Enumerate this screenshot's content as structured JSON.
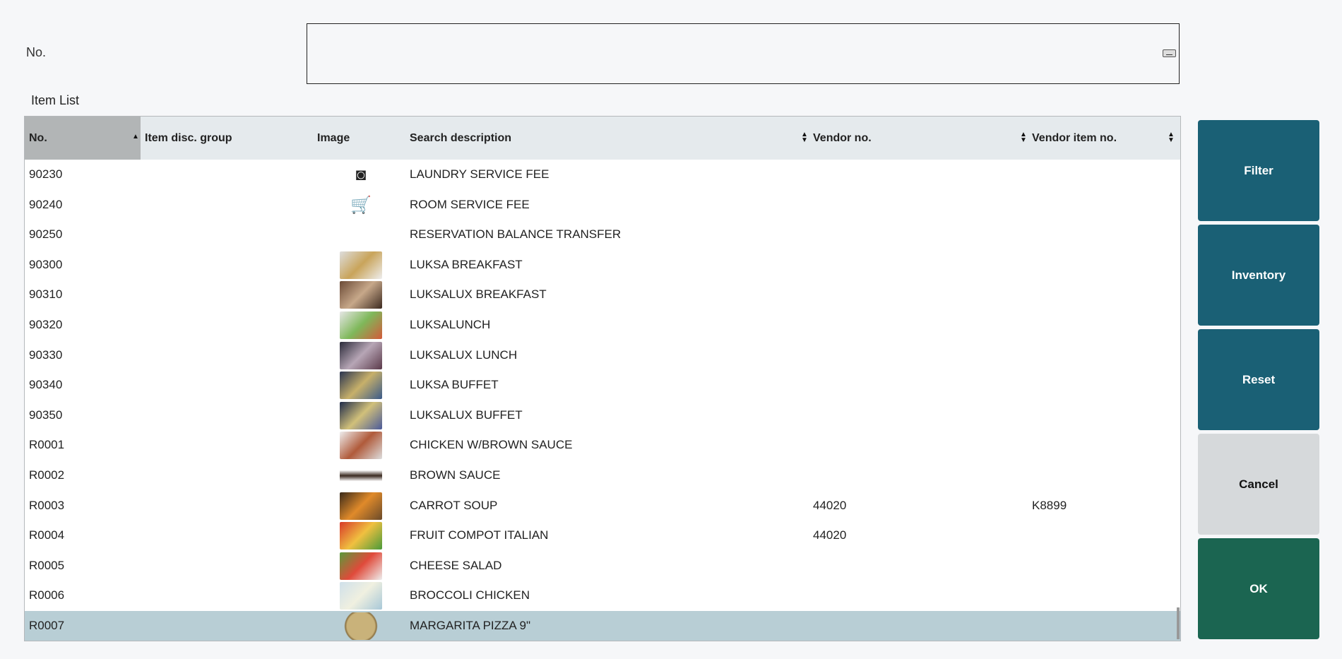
{
  "form": {
    "no_label": "No.",
    "no_value": "",
    "list_label": "Item List"
  },
  "columns": {
    "no": "No.",
    "disc_group": "Item disc. group",
    "image": "Image",
    "search_desc": "Search description",
    "vendor_no": "Vendor no.",
    "vendor_item_no": "Vendor item no."
  },
  "rows": [
    {
      "no": "90230",
      "desc": "LAUNDRY SERVICE FEE",
      "vendor": "",
      "vitem": "",
      "img": "laundry-icon"
    },
    {
      "no": "90240",
      "desc": "ROOM SERVICE FEE",
      "vendor": "",
      "vitem": "",
      "img": "room-service-icon"
    },
    {
      "no": "90250",
      "desc": "RESERVATION BALANCE TRANSFER",
      "vendor": "",
      "vitem": "",
      "img": ""
    },
    {
      "no": "90300",
      "desc": "LUKSA BREAKFAST",
      "vendor": "",
      "vitem": "",
      "img": "photo"
    },
    {
      "no": "90310",
      "desc": "LUKSALUX BREAKFAST",
      "vendor": "",
      "vitem": "",
      "img": "photo"
    },
    {
      "no": "90320",
      "desc": "LUKSALUNCH",
      "vendor": "",
      "vitem": "",
      "img": "photo"
    },
    {
      "no": "90330",
      "desc": "LUKSALUX LUNCH",
      "vendor": "",
      "vitem": "",
      "img": "photo"
    },
    {
      "no": "90340",
      "desc": "LUKSA BUFFET",
      "vendor": "",
      "vitem": "",
      "img": "photo"
    },
    {
      "no": "90350",
      "desc": "LUKSALUX BUFFET",
      "vendor": "",
      "vitem": "",
      "img": "photo"
    },
    {
      "no": "R0001",
      "desc": "CHICKEN W/BROWN SAUCE",
      "vendor": "",
      "vitem": "",
      "img": "photo"
    },
    {
      "no": "R0002",
      "desc": "BROWN SAUCE",
      "vendor": "",
      "vitem": "",
      "img": "photo"
    },
    {
      "no": "R0003",
      "desc": "CARROT SOUP",
      "vendor": "44020",
      "vitem": "K8899",
      "img": "photo"
    },
    {
      "no": "R0004",
      "desc": "FRUIT COMPOT ITALIAN",
      "vendor": "44020",
      "vitem": "",
      "img": "photo"
    },
    {
      "no": "R0005",
      "desc": "CHEESE SALAD",
      "vendor": "",
      "vitem": "",
      "img": "photo"
    },
    {
      "no": "R0006",
      "desc": "BROCCOLI CHICKEN",
      "vendor": "",
      "vitem": "",
      "img": "photo"
    },
    {
      "no": "R0007",
      "desc": "MARGARITA PIZZA 9\"",
      "vendor": "",
      "vitem": "",
      "img": "photo",
      "selected": true
    }
  ],
  "buttons": {
    "filter": "Filter",
    "inventory": "Inventory",
    "reset": "Reset",
    "cancel": "Cancel",
    "ok": "OK"
  },
  "colors": {
    "primary": "#1a6075",
    "cancel": "#d6d9db",
    "ok": "#1b6551",
    "selected_row": "#b8ced5"
  }
}
